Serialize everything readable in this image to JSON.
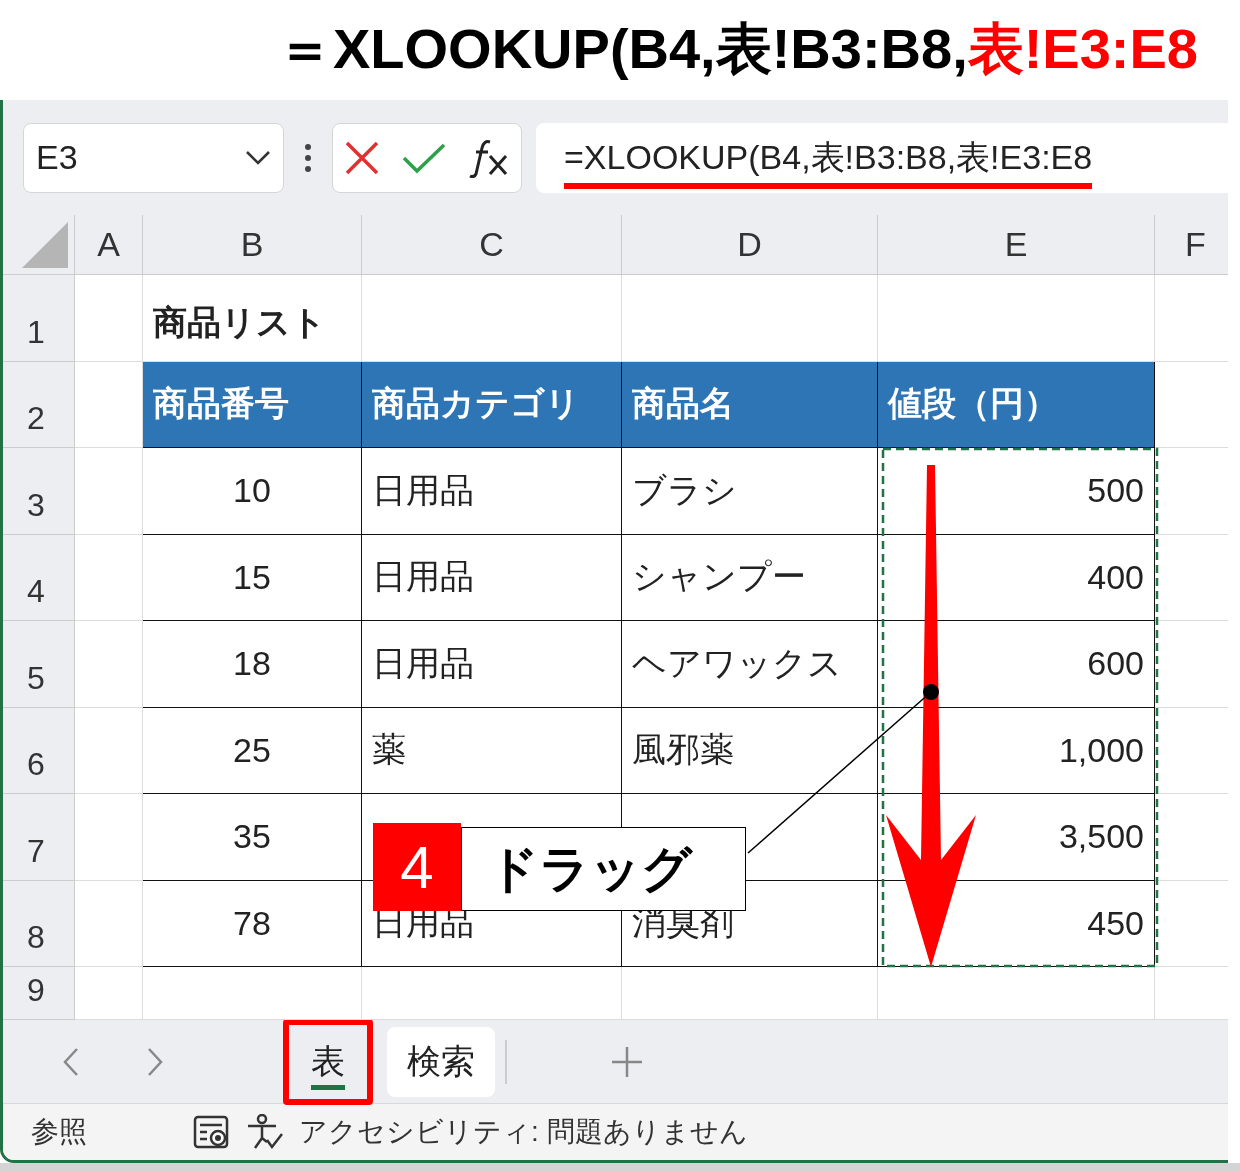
{
  "headline": {
    "segments": [
      {
        "text": "＝XLOOKUP(B4,表!B3:B8,",
        "highlight": false
      },
      {
        "text": "表!E3:E8",
        "highlight": true
      }
    ]
  },
  "name_box": {
    "value": "E3"
  },
  "formula_bar": {
    "value": "=XLOOKUP(B4,表!B3:B8,表!E3:E8",
    "underlined": true
  },
  "columns": [
    "A",
    "B",
    "C",
    "D",
    "E",
    "F"
  ],
  "rows": [
    {
      "number": "1",
      "kind": "title",
      "B": "商品リスト"
    },
    {
      "number": "2",
      "kind": "header",
      "B": "商品番号",
      "C": "商品カテゴリ",
      "D": "商品名",
      "E": "値段（円）"
    },
    {
      "number": "3",
      "kind": "data",
      "B": "10",
      "C": "日用品",
      "D": "ブラシ",
      "E": "500"
    },
    {
      "number": "4",
      "kind": "data",
      "B": "15",
      "C": "日用品",
      "D": "シャンプー",
      "E": "400"
    },
    {
      "number": "5",
      "kind": "data",
      "B": "18",
      "C": "日用品",
      "D": "ヘアワックス",
      "E": "600"
    },
    {
      "number": "6",
      "kind": "data",
      "B": "25",
      "C": "薬",
      "D": "風邪薬",
      "E": "1,000"
    },
    {
      "number": "7",
      "kind": "data",
      "B": "35",
      "E": "3,500"
    },
    {
      "number": "8",
      "kind": "data",
      "B": "78",
      "C": "日用品",
      "D": "消臭剤",
      "E": "450"
    },
    {
      "number": "9",
      "kind": "blank"
    }
  ],
  "callout": {
    "step": "4",
    "label": "ドラッグ"
  },
  "sheet_tabs": [
    {
      "label": "表",
      "selected": true,
      "highlighted": true
    },
    {
      "label": "検索",
      "selected": false,
      "highlighted": false
    }
  ],
  "status_bar": {
    "mode": "参照",
    "accessibility": "アクセシビリティ: 問題ありません"
  }
}
